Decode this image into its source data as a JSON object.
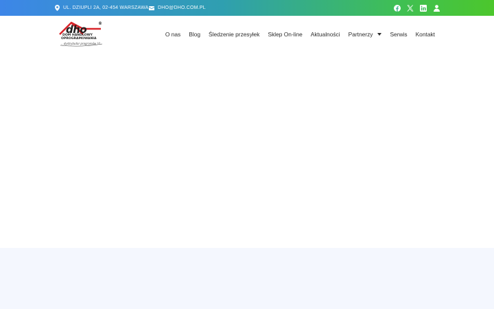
{
  "topbar": {
    "address": "UL. DZIUPLI 2A, 02-454 WARSZAWA",
    "email": "DHO@DHO.COM.PL",
    "address_icon": "map-pin-icon",
    "email_icon": "envelope-icon",
    "socials": [
      "facebook-icon",
      "x-twitter-icon",
      "linkedin-icon",
      "user-account-icon"
    ],
    "gradient": [
      "#3d86e8",
      "#2f9fb0",
      "#3fbf55",
      "#4cc72c"
    ]
  },
  "logo": {
    "brand": "dho",
    "line1": "DOM HANDLOWY",
    "line2": "OPROGRAMOWANIA",
    "tagline": "...dystrybutor programów !!!",
    "registered": "®",
    "roof_color": "#d8242a"
  },
  "nav": {
    "items": [
      "O nas",
      "Blog",
      "Śledzenie przesyłek",
      "Sklep On-line",
      "Aktualności",
      "Partnerzy",
      "Serwis",
      "Kontakt"
    ],
    "dropdown_icon": "caret-down-icon"
  },
  "colors": {
    "text": "#2d2d2d",
    "band": "#f4f7fe"
  }
}
